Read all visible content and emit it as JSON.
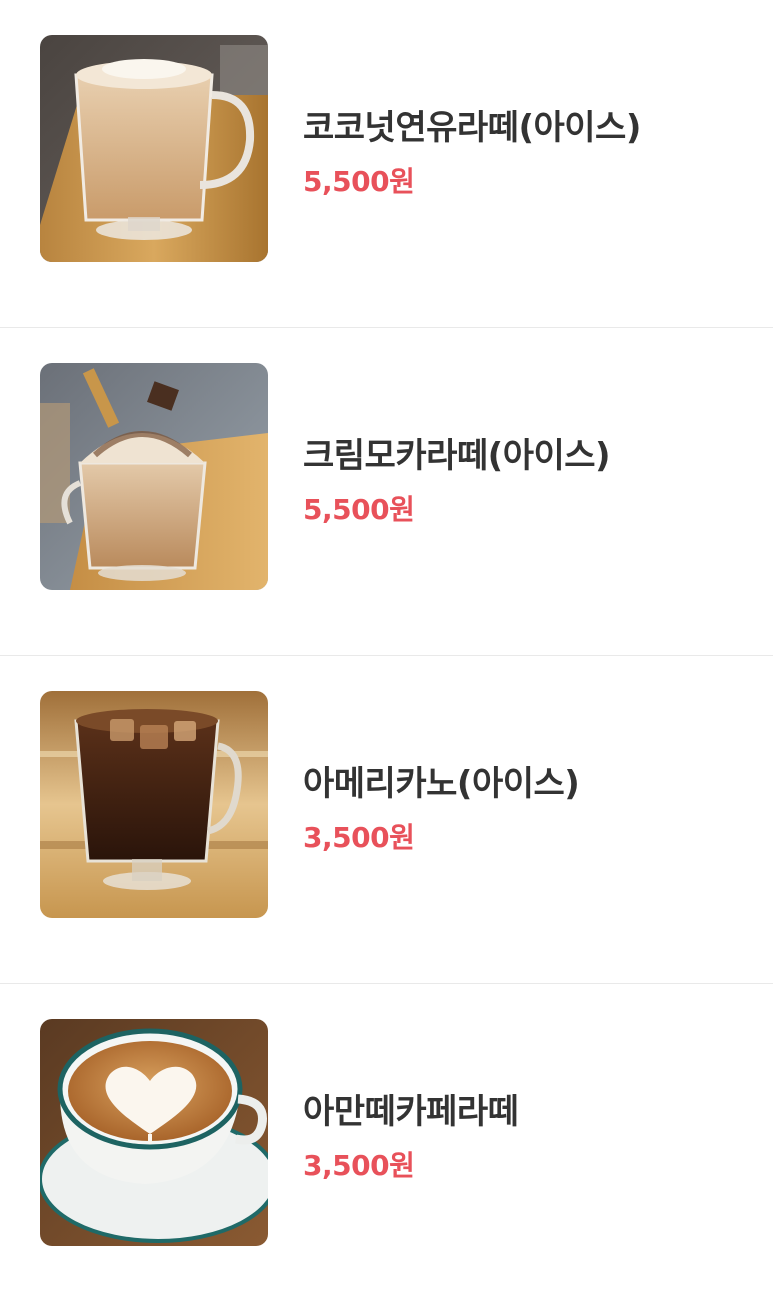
{
  "theme": {
    "price_color": "#e8515a",
    "name_color": "#333333",
    "divider_color": "#e9e9e9"
  },
  "menu": {
    "items": [
      {
        "name": "코코넛연유라떼(아이스)",
        "price": "5,500원",
        "image": "iced-coconut-latte-photo"
      },
      {
        "name": "크림모카라떼(아이스)",
        "price": "5,500원",
        "image": "iced-cream-mocha-photo"
      },
      {
        "name": "아메리카노(아이스)",
        "price": "3,500원",
        "image": "iced-americano-photo"
      },
      {
        "name": "아만떼카페라떼",
        "price": "3,500원",
        "image": "latte-art-cup-photo"
      }
    ]
  }
}
